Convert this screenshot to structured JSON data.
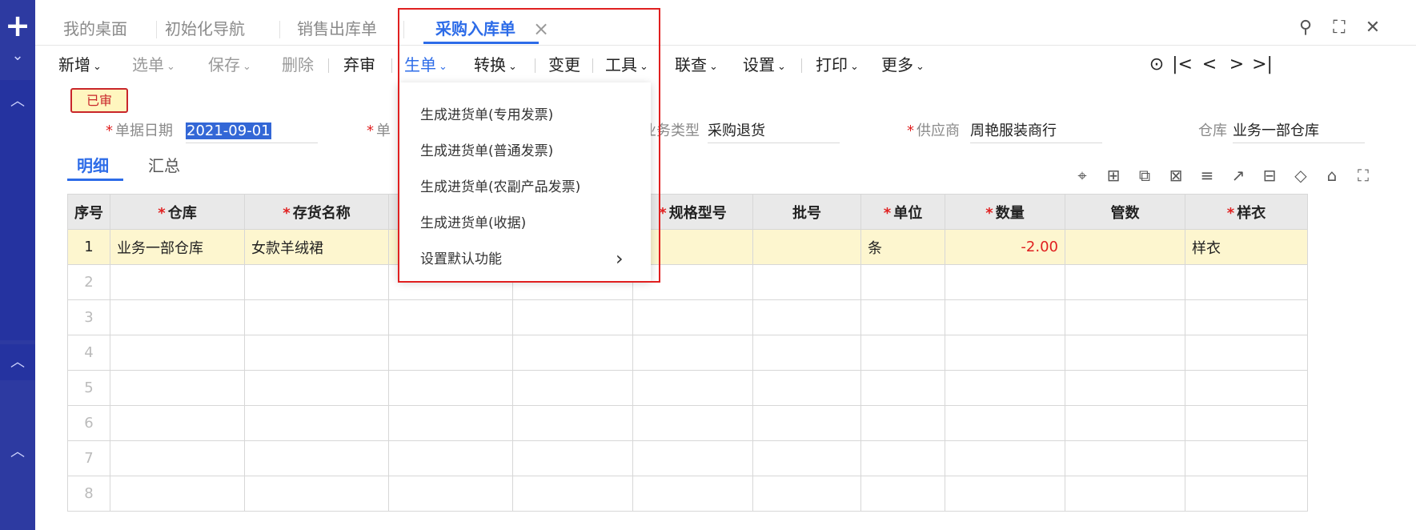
{
  "left_rail": {
    "plus": "+"
  },
  "tabs": [
    {
      "label": "我的桌面"
    },
    {
      "label": "初始化导航"
    },
    {
      "label": "销售出库单"
    },
    {
      "label": "采购入库单",
      "close": "×"
    }
  ],
  "window_buttons": {
    "search": "⚲",
    "fullscreen": "⛶",
    "close": "✕"
  },
  "toolbar": {
    "items": [
      "新增",
      "选单",
      "保存",
      "删除",
      "弃审",
      "生单",
      "转换",
      "变更",
      "工具",
      "联查",
      "设置",
      "打印",
      "更多"
    ],
    "nav": [
      "⊙",
      "|<",
      "<",
      ">",
      ">|"
    ]
  },
  "status_badge": "已审",
  "form": {
    "date_label": "单据日期",
    "date_value": "2021-09-01",
    "doc_label": "单",
    "biz_type_label": "业务类型",
    "biz_type_value": "采购退货",
    "supplier_label": "供应商",
    "supplier_value": "周艳服装商行",
    "warehouse_label": "仓库",
    "warehouse_value": "业务一部仓库"
  },
  "subtabs": [
    "明细",
    "汇总"
  ],
  "grid": {
    "headers": [
      "序号",
      "仓库",
      "存货名称",
      "",
      "",
      "规格型号",
      "批号",
      "单位",
      "数量",
      "管数",
      "样衣"
    ],
    "rows": [
      [
        "1",
        "业务一部仓库",
        "女款羊绒裙",
        "",
        "",
        "",
        "",
        "条",
        "-2.00",
        "",
        "样衣"
      ],
      [
        "2"
      ],
      [
        "3"
      ],
      [
        "4"
      ],
      [
        "5"
      ],
      [
        "6"
      ],
      [
        "7"
      ],
      [
        "8"
      ]
    ]
  },
  "dropdown": {
    "items": [
      "生成进货单(专用发票)",
      "生成进货单(普通发票)",
      "生成进货单(农副产品发票)",
      "生成进货单(收据)",
      "设置默认功能"
    ],
    "submenu_arrow": "›"
  },
  "colors": {
    "accent": "#2d6ce8",
    "rail": "#2d3aa1",
    "highlight_box": "#e02020",
    "badge_bg": "#fff6bf"
  }
}
